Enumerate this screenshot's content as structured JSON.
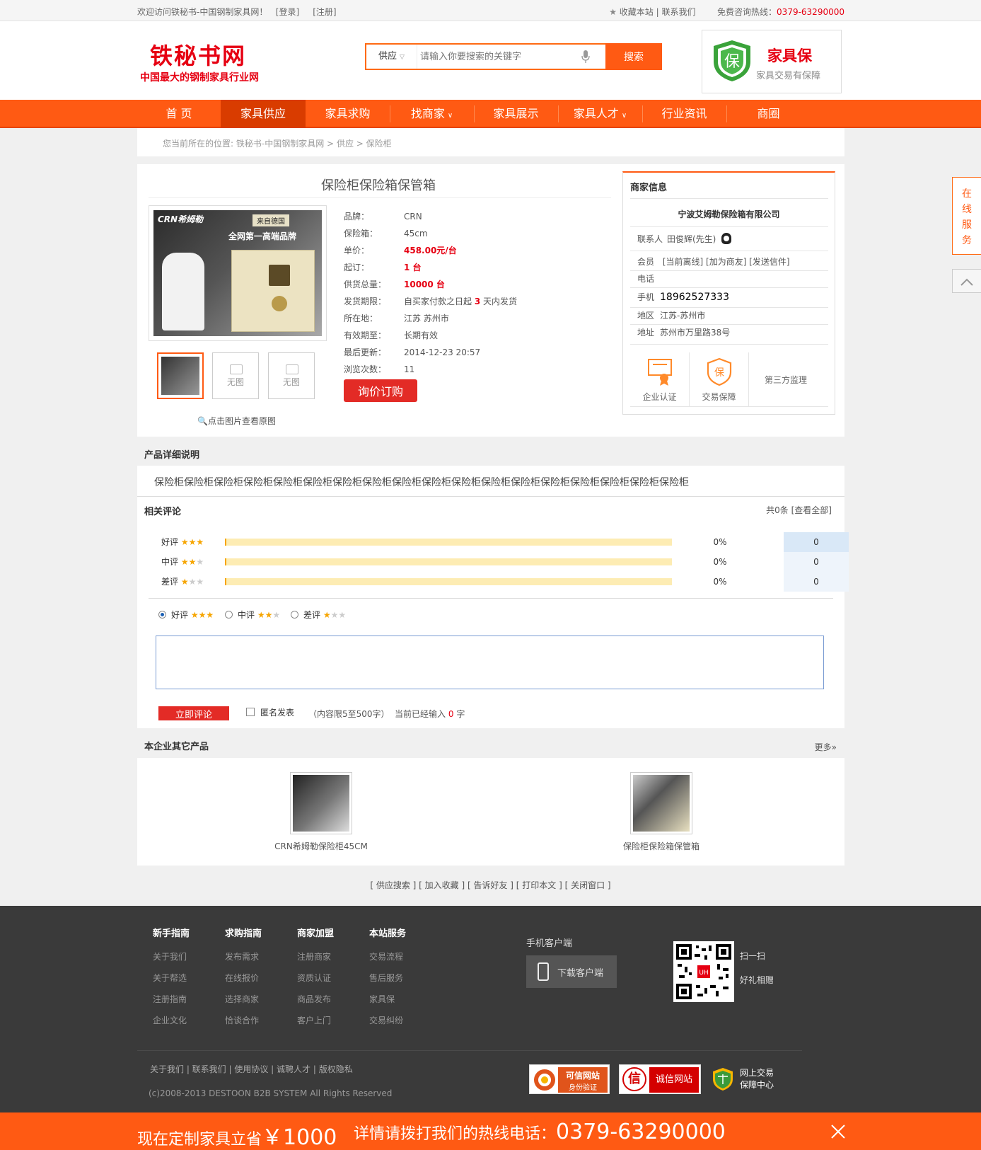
{
  "topbar": {
    "welcome": "欢迎访问铁秘书-中国钢制家具网！",
    "login": "[登录]",
    "register": "[注册]",
    "favorite": "收藏本站",
    "contact": "联系我们",
    "hotline_label": "免费咨询热线：",
    "hotline": "0379-63290000"
  },
  "header": {
    "logo_title": "铁秘书网",
    "logo_sub": "中国最大的钢制家具行业网",
    "search_category": "供应",
    "search_placeholder": "请输入你要搜索的关键字",
    "search_button": "搜索",
    "badge_icon_char": "保",
    "badge_title": "家具保",
    "badge_sub": "家具交易有保障"
  },
  "nav": {
    "items": [
      "首 页",
      "家具供应",
      "家具求购",
      "找商家",
      "家具展示",
      "家具人才",
      "行业资讯",
      "商圈"
    ],
    "active": "家具供应"
  },
  "breadcrumb": {
    "prefix": "您当前所在的位置:",
    "path": [
      "铁秘书-中国钢制家具网",
      "供应",
      "保险柜"
    ],
    "sep": ">"
  },
  "product": {
    "title": "保险柜保险箱保管箱",
    "image_brand": "CRN希姆勒",
    "image_text1": "来自德国",
    "image_text2": "全网第一高端品牌",
    "thumb_no_image": "无图",
    "view_original": "点击图片查看原图",
    "specs": [
      {
        "k": "品牌：",
        "v": "CRN",
        "red": false
      },
      {
        "k": "保险箱：",
        "v": "45cm",
        "red": false
      },
      {
        "k": "单价：",
        "v": "458.00元/台",
        "red": true
      },
      {
        "k": "起订：",
        "v": "1 台",
        "red": true
      },
      {
        "k": "供货总量：",
        "v": "10000 台",
        "red": true
      },
      {
        "k": "发货期限：",
        "v": "自买家付款之日起",
        "red": false
      },
      {
        "k": "所在地：",
        "v": "江苏 苏州市",
        "red": false
      },
      {
        "k": "有效期至：",
        "v": "长期有效",
        "red": false
      },
      {
        "k": "最后更新：",
        "v": "2014-12-23 20:57",
        "red": false
      },
      {
        "k": "浏览次数：",
        "v": "11",
        "red": false
      }
    ],
    "ship_days": "3",
    "ship_suffix": "天内发货",
    "inquiry_button": "询价订购"
  },
  "merchant": {
    "heading": "商家信息",
    "company": "宁波艾姆勒保险箱有限公司",
    "contact_label": "联系人",
    "contact": "田俊辉(先生)",
    "member_label": "会员",
    "member_links": "[当前离线] [加为商友] [发送信件]",
    "phone_label": "电话",
    "mobile_label": "手机",
    "mobile": "18962527333",
    "region_label": "地区",
    "region": "江苏-苏州市",
    "address_label": "地址",
    "address": "苏州市万里路38号",
    "certs": [
      "企业认证",
      "交易保障",
      "第三方监理"
    ]
  },
  "details": {
    "heading": "产品详细说明",
    "body": "保险柜保险柜保险柜保险柜保险柜保险柜保险柜保险柜保险柜保险柜保险柜保险柜保险柜保险柜保险柜保险柜保险柜保险柜"
  },
  "reviews": {
    "heading": "相关评论",
    "total": "共0条 [查看全部]",
    "rows": [
      {
        "label": "好评",
        "stars": 3,
        "pct": "0%",
        "count": "0",
        "fill": 0
      },
      {
        "label": "中评",
        "stars": 2,
        "pct": "0%",
        "count": "0",
        "fill": 0
      },
      {
        "label": "差评",
        "stars": 1,
        "pct": "0%",
        "count": "0",
        "fill": 0
      }
    ],
    "options": [
      "好评",
      "中评",
      "差评"
    ],
    "selected_option": "好评",
    "submit": "立即评论",
    "anonymous": "匿名发表",
    "limit": "（内容限5至500字）",
    "typed_prefix": "当前已经输入",
    "typed_count": "0",
    "typed_suffix": "字"
  },
  "others": {
    "heading": "本企业其它产品",
    "more": "更多»",
    "items": [
      "CRN希姆勒保险柜45CM",
      "保险柜保险箱保管箱"
    ]
  },
  "bottom_links": "[ 供应搜索 ] [ 加入收藏 ] [ 告诉好友 ] [ 打印本文 ] [ 关闭窗口 ]",
  "footer": {
    "columns": [
      {
        "h": "新手指南",
        "items": [
          "关于我们",
          "关于帮选",
          "注册指南",
          "企业文化"
        ]
      },
      {
        "h": "求购指南",
        "items": [
          "发布需求",
          "在线报价",
          "选择商家",
          "恰谈合作"
        ]
      },
      {
        "h": "商家加盟",
        "items": [
          "注册商家",
          "资质认证",
          "商品发布",
          "客户上门"
        ]
      },
      {
        "h": "本站服务",
        "items": [
          "交易流程",
          "售后服务",
          "家具保",
          "交易纠纷"
        ]
      }
    ],
    "app_heading": "手机客户端",
    "app_button": "下载客户端",
    "scan": "扫一扫",
    "gift": "好礼相赠",
    "qr_badge": "UH",
    "links": "关于我们 | 联系我们 | 使用协议 | 诚聘人才 | 版权隐私",
    "copyright": "(c)2008-2013 DESTOON B2B SYSTEM All Rights Reserved",
    "trust1_a": "可信网站",
    "trust1_b": "身份验证",
    "trust2_icon": "信",
    "trust2": "诚信网站",
    "trust3_a": "网上交易",
    "trust3_b": "保障中心"
  },
  "banner": {
    "text1": "现在定制家具立省",
    "amount": "￥1000",
    "text2": "详情请拨打我们的热线电话：",
    "phone": "0379-63290000"
  },
  "side": {
    "online": [
      "在",
      "线",
      "服",
      "务"
    ]
  },
  "colors": {
    "brand_orange": "#ff5a13",
    "red": "#e60012",
    "footer_bg": "#3a3a3a"
  }
}
